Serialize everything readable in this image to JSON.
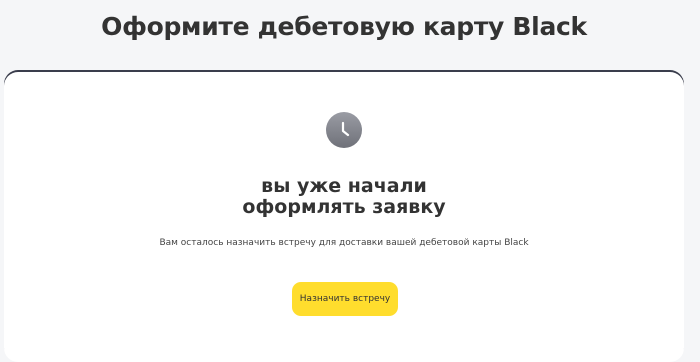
{
  "page": {
    "title": "Оформите дебетовую карту Black"
  },
  "card": {
    "icon": "clock-icon",
    "headline_line1": "вы уже начали",
    "headline_line2": "оформлять заявку",
    "subtext": "Вам осталось назначить встречу для доставки вашей дебетовой карты Black",
    "cta_label": "Назначить встречу"
  },
  "colors": {
    "background": "#f5f6f8",
    "card": "#ffffff",
    "card_top_border": "#3a3d4c",
    "accent": "#ffdd2d",
    "text": "#333333",
    "icon_bg": "#7d7f87"
  }
}
